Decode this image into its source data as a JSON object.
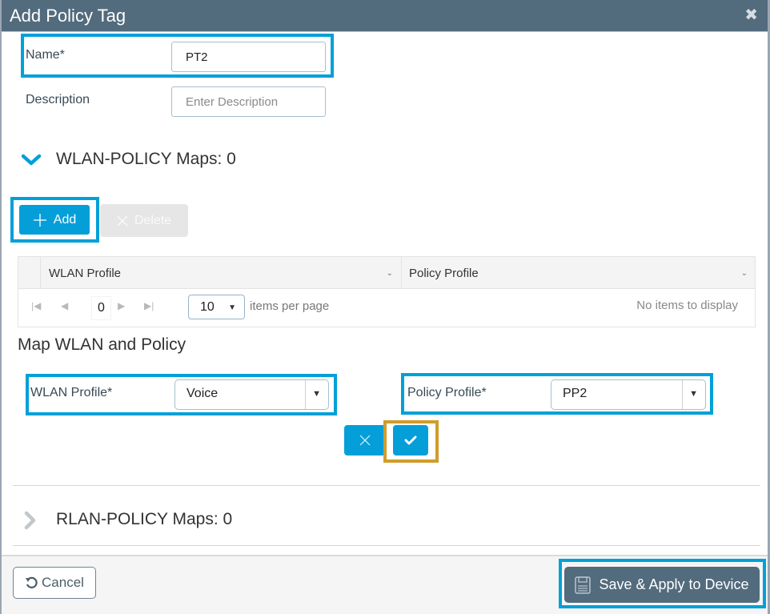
{
  "dialog": {
    "title": "Add Policy Tag",
    "close_icon": "close-icon"
  },
  "form": {
    "name_label": "Name*",
    "name_value": "PT2",
    "description_label": "Description",
    "description_placeholder": "Enter Description"
  },
  "wlan_section": {
    "title": "WLAN-POLICY Maps: 0",
    "expanded": true,
    "add_label": "Add",
    "delete_label": "Delete",
    "grid": {
      "columns": [
        "WLAN Profile",
        "Policy Profile"
      ],
      "rows": [],
      "page": "0",
      "page_size": "10",
      "items_per_page_label": "items per page",
      "empty_text": "No items to display"
    }
  },
  "map": {
    "title": "Map WLAN and Policy",
    "wlan_profile_label": "WLAN Profile*",
    "wlan_profile_value": "Voice",
    "policy_profile_label": "Policy Profile*",
    "policy_profile_value": "PP2"
  },
  "rlan_section": {
    "title": "RLAN-POLICY Maps: 0",
    "expanded": false
  },
  "footer": {
    "cancel_label": "Cancel",
    "save_label": "Save & Apply to Device"
  },
  "colors": {
    "header_bg": "#526b7d",
    "primary_blue": "#049fd9",
    "highlight_blue": "#00a0d8",
    "highlight_gold": "#d09c2a"
  }
}
